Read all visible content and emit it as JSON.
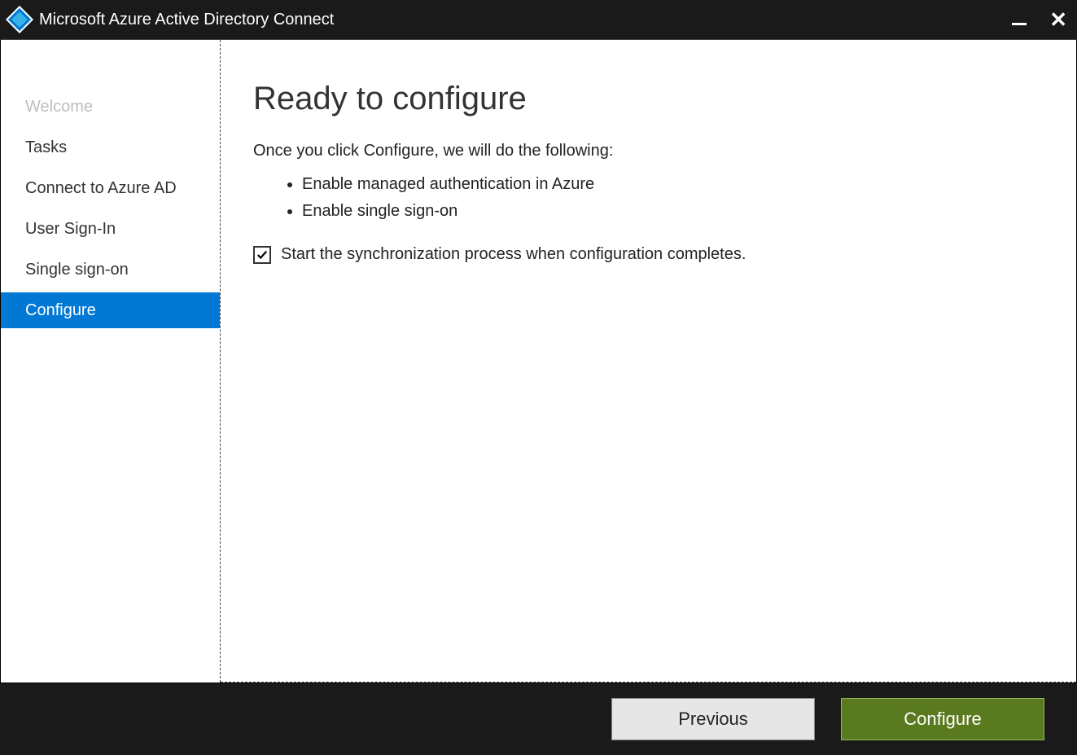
{
  "window": {
    "title": "Microsoft Azure Active Directory Connect"
  },
  "sidebar": {
    "items": [
      {
        "label": "Welcome",
        "state": "disabled"
      },
      {
        "label": "Tasks",
        "state": "normal"
      },
      {
        "label": "Connect to Azure AD",
        "state": "normal"
      },
      {
        "label": "User Sign-In",
        "state": "normal"
      },
      {
        "label": "Single sign-on",
        "state": "normal"
      },
      {
        "label": "Configure",
        "state": "active"
      }
    ]
  },
  "main": {
    "heading": "Ready to configure",
    "lead": "Once you click Configure, we will do the following:",
    "bullets": [
      "Enable managed authentication in Azure",
      "Enable single sign-on"
    ],
    "checkbox": {
      "checked": true,
      "label": "Start the synchronization process when configuration completes."
    }
  },
  "footer": {
    "previous": "Previous",
    "configure": "Configure"
  }
}
